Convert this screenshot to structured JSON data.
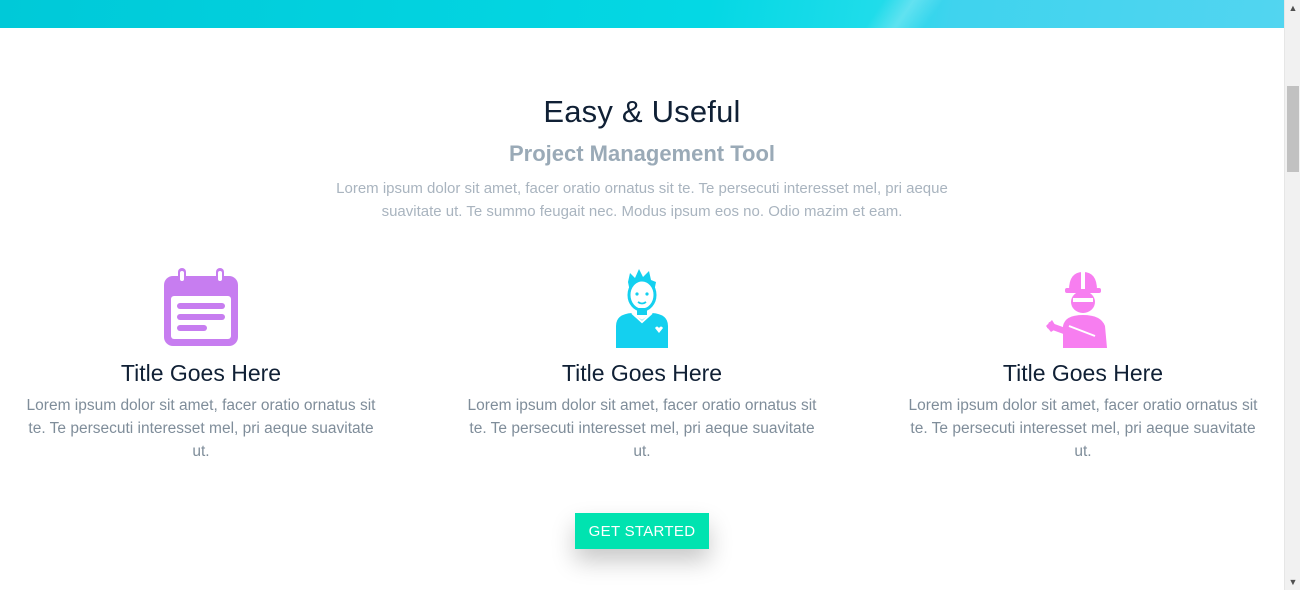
{
  "hero": {
    "title": "Easy & Useful",
    "subtitle": "Project Management Tool",
    "description": "Lorem ipsum dolor sit amet, facer oratio ornatus sit te. Te persecuti interesset mel, pri aeque suavitate ut. Te summo feugait nec. Modus ipsum eos no. Odio mazim et eam."
  },
  "features": [
    {
      "icon": "calendar-icon",
      "icon_color": "#c77df0",
      "title": "Title Goes Here",
      "text": "Lorem ipsum dolor sit amet, facer oratio ornatus sit te. Te persecuti interesset mel, pri aeque suavitate ut."
    },
    {
      "icon": "person-icon",
      "icon_color": "#14d0ef",
      "title": "Title Goes Here",
      "text": "Lorem ipsum dolor sit amet, facer oratio ornatus sit te. Te persecuti interesset mel, pri aeque suavitate ut."
    },
    {
      "icon": "worker-icon",
      "icon_color": "#f77ef0",
      "title": "Title Goes Here",
      "text": "Lorem ipsum dolor sit amet, facer oratio ornatus sit te. Te persecuti interesset mel, pri aeque suavitate ut."
    }
  ],
  "cta": {
    "label": "GET STARTED",
    "color": "#00e3b0"
  },
  "colors": {
    "banner": "#04d8e4",
    "heading": "#102035",
    "muted": "#9aaab7"
  }
}
